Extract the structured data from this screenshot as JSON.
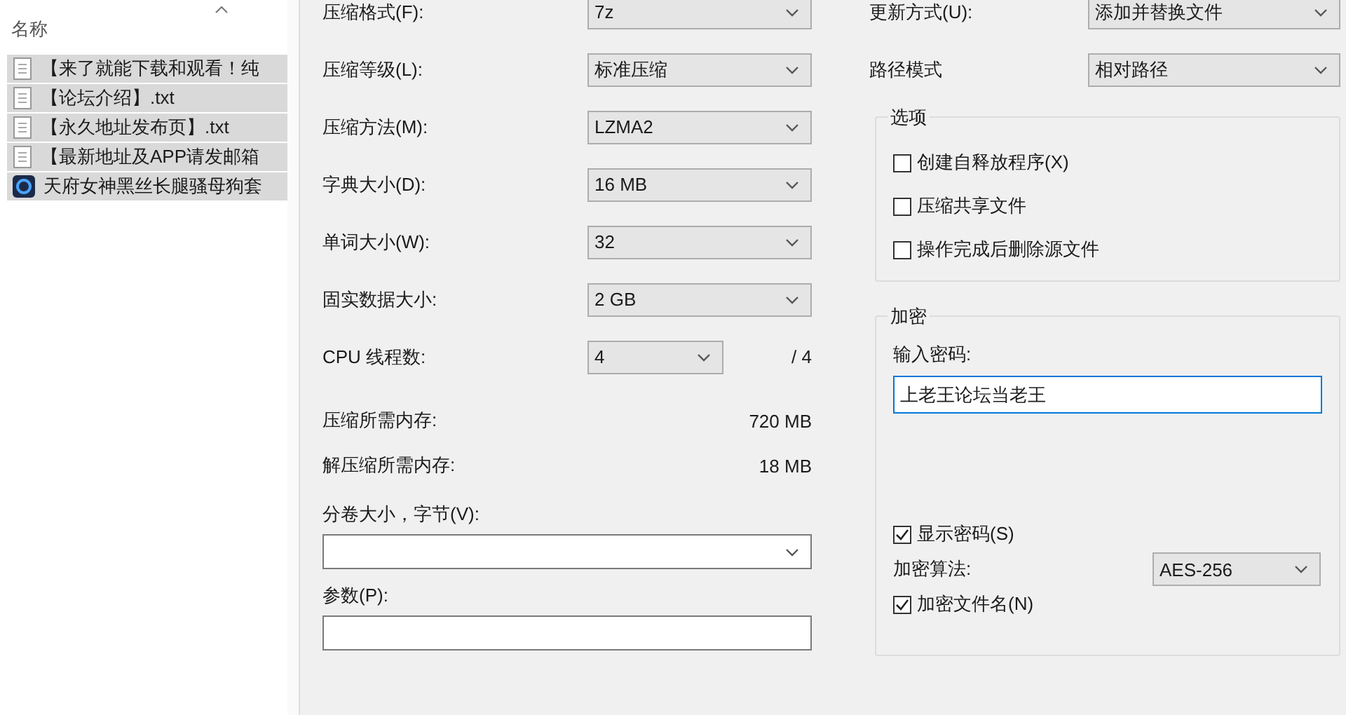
{
  "file_list": {
    "header": "名称",
    "rows": [
      {
        "name": "【来了就能下载和观看！纯",
        "kind": "text",
        "selected": true
      },
      {
        "name": "【论坛介绍】.txt",
        "kind": "text",
        "selected": true
      },
      {
        "name": "【永久地址发布页】.txt",
        "kind": "text",
        "selected": true
      },
      {
        "name": "【最新地址及APP请发邮箱",
        "kind": "text",
        "selected": true
      },
      {
        "name": "天府女神黑丝长腿骚母狗套",
        "kind": "app",
        "selected": true
      }
    ]
  },
  "settings": [
    {
      "label": "压缩格式(F):",
      "value": "7z"
    },
    {
      "label": "压缩等级(L):",
      "value": "标准压缩"
    },
    {
      "label": "压缩方法(M):",
      "value": "LZMA2"
    },
    {
      "label": "字典大小(D):",
      "value": "16 MB"
    },
    {
      "label": "单词大小(W):",
      "value": "32"
    },
    {
      "label": "固实数据大小:",
      "value": "2 GB"
    }
  ],
  "cpu_threads": {
    "label": "CPU 线程数:",
    "value": "4",
    "total": "/ 4"
  },
  "memory": [
    {
      "label": "压缩所需内存:",
      "value": "720 MB"
    },
    {
      "label": "解压缩所需内存:",
      "value": "18 MB"
    }
  ],
  "volume_size": {
    "label": "分卷大小，字节(V):"
  },
  "parameters": {
    "label": "参数(P):"
  },
  "update_mode": {
    "label": "更新方式(U):",
    "value": "添加并替换文件"
  },
  "path_mode": {
    "label": "路径模式",
    "value": "相对路径"
  },
  "options": {
    "title": "选项",
    "items": [
      {
        "label": "创建自释放程序(X)",
        "checked": false
      },
      {
        "label": "压缩共享文件",
        "checked": false
      },
      {
        "label": "操作完成后删除源文件",
        "checked": false
      }
    ]
  },
  "encryption": {
    "title": "加密",
    "password_label": "输入密码:",
    "password": "上老王论坛当老王",
    "show_password": {
      "label": "显示密码(S)",
      "checked": true
    },
    "method": {
      "label": "加密算法:",
      "value": "AES-256"
    },
    "encrypt_names": {
      "label": "加密文件名(N)",
      "checked": true
    }
  }
}
